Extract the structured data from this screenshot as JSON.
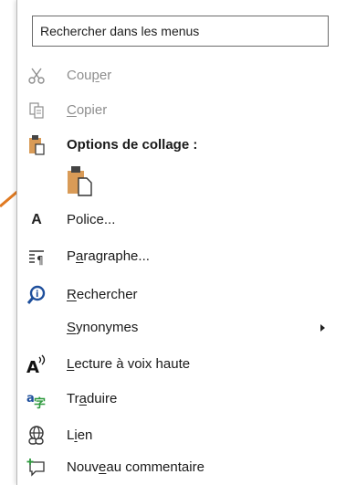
{
  "search": {
    "placeholder": "Rechercher dans les menus"
  },
  "items": [
    {
      "pre": "Cou",
      "u": "p",
      "post": "er",
      "icon": "scissors-icon",
      "enabled": false
    },
    {
      "pre": "",
      "u": "C",
      "post": "opier",
      "icon": "copy-icon",
      "enabled": false
    },
    {
      "pre": "Options de collage :",
      "u": "",
      "post": "",
      "icon": "clipboard-icon",
      "enabled": true,
      "header": true
    },
    {
      "pre": "Police",
      "u": "",
      "post": "...",
      "icon": "font-icon",
      "enabled": true
    },
    {
      "pre": "P",
      "u": "a",
      "post": "ragraphe...",
      "icon": "paragraph-icon",
      "enabled": true
    },
    {
      "pre": "",
      "u": "R",
      "post": "echercher",
      "icon": "smart-lookup-icon",
      "enabled": true
    },
    {
      "pre": "",
      "u": "S",
      "post": "ynonymes",
      "icon": "",
      "enabled": true,
      "submenu": true
    },
    {
      "pre": "",
      "u": "L",
      "post": "ecture à voix haute",
      "icon": "read-aloud-icon",
      "enabled": true
    },
    {
      "pre": "Tr",
      "u": "a",
      "post": "duire",
      "icon": "translate-icon",
      "enabled": true
    },
    {
      "pre": "L",
      "u": "i",
      "post": "en",
      "icon": "link-icon",
      "enabled": true
    },
    {
      "pre": "Nouv",
      "u": "e",
      "post": "au commentaire",
      "icon": "new-comment-icon",
      "enabled": true
    }
  ],
  "paste_options": [
    {
      "icon": "keep-text-only-paste-icon"
    }
  ],
  "colors": {
    "accent_orange": "#e07a22",
    "clipboard_tan": "#d99b57",
    "icon_blue": "#1e4f9c",
    "disabled_text": "#8e8e8e"
  }
}
